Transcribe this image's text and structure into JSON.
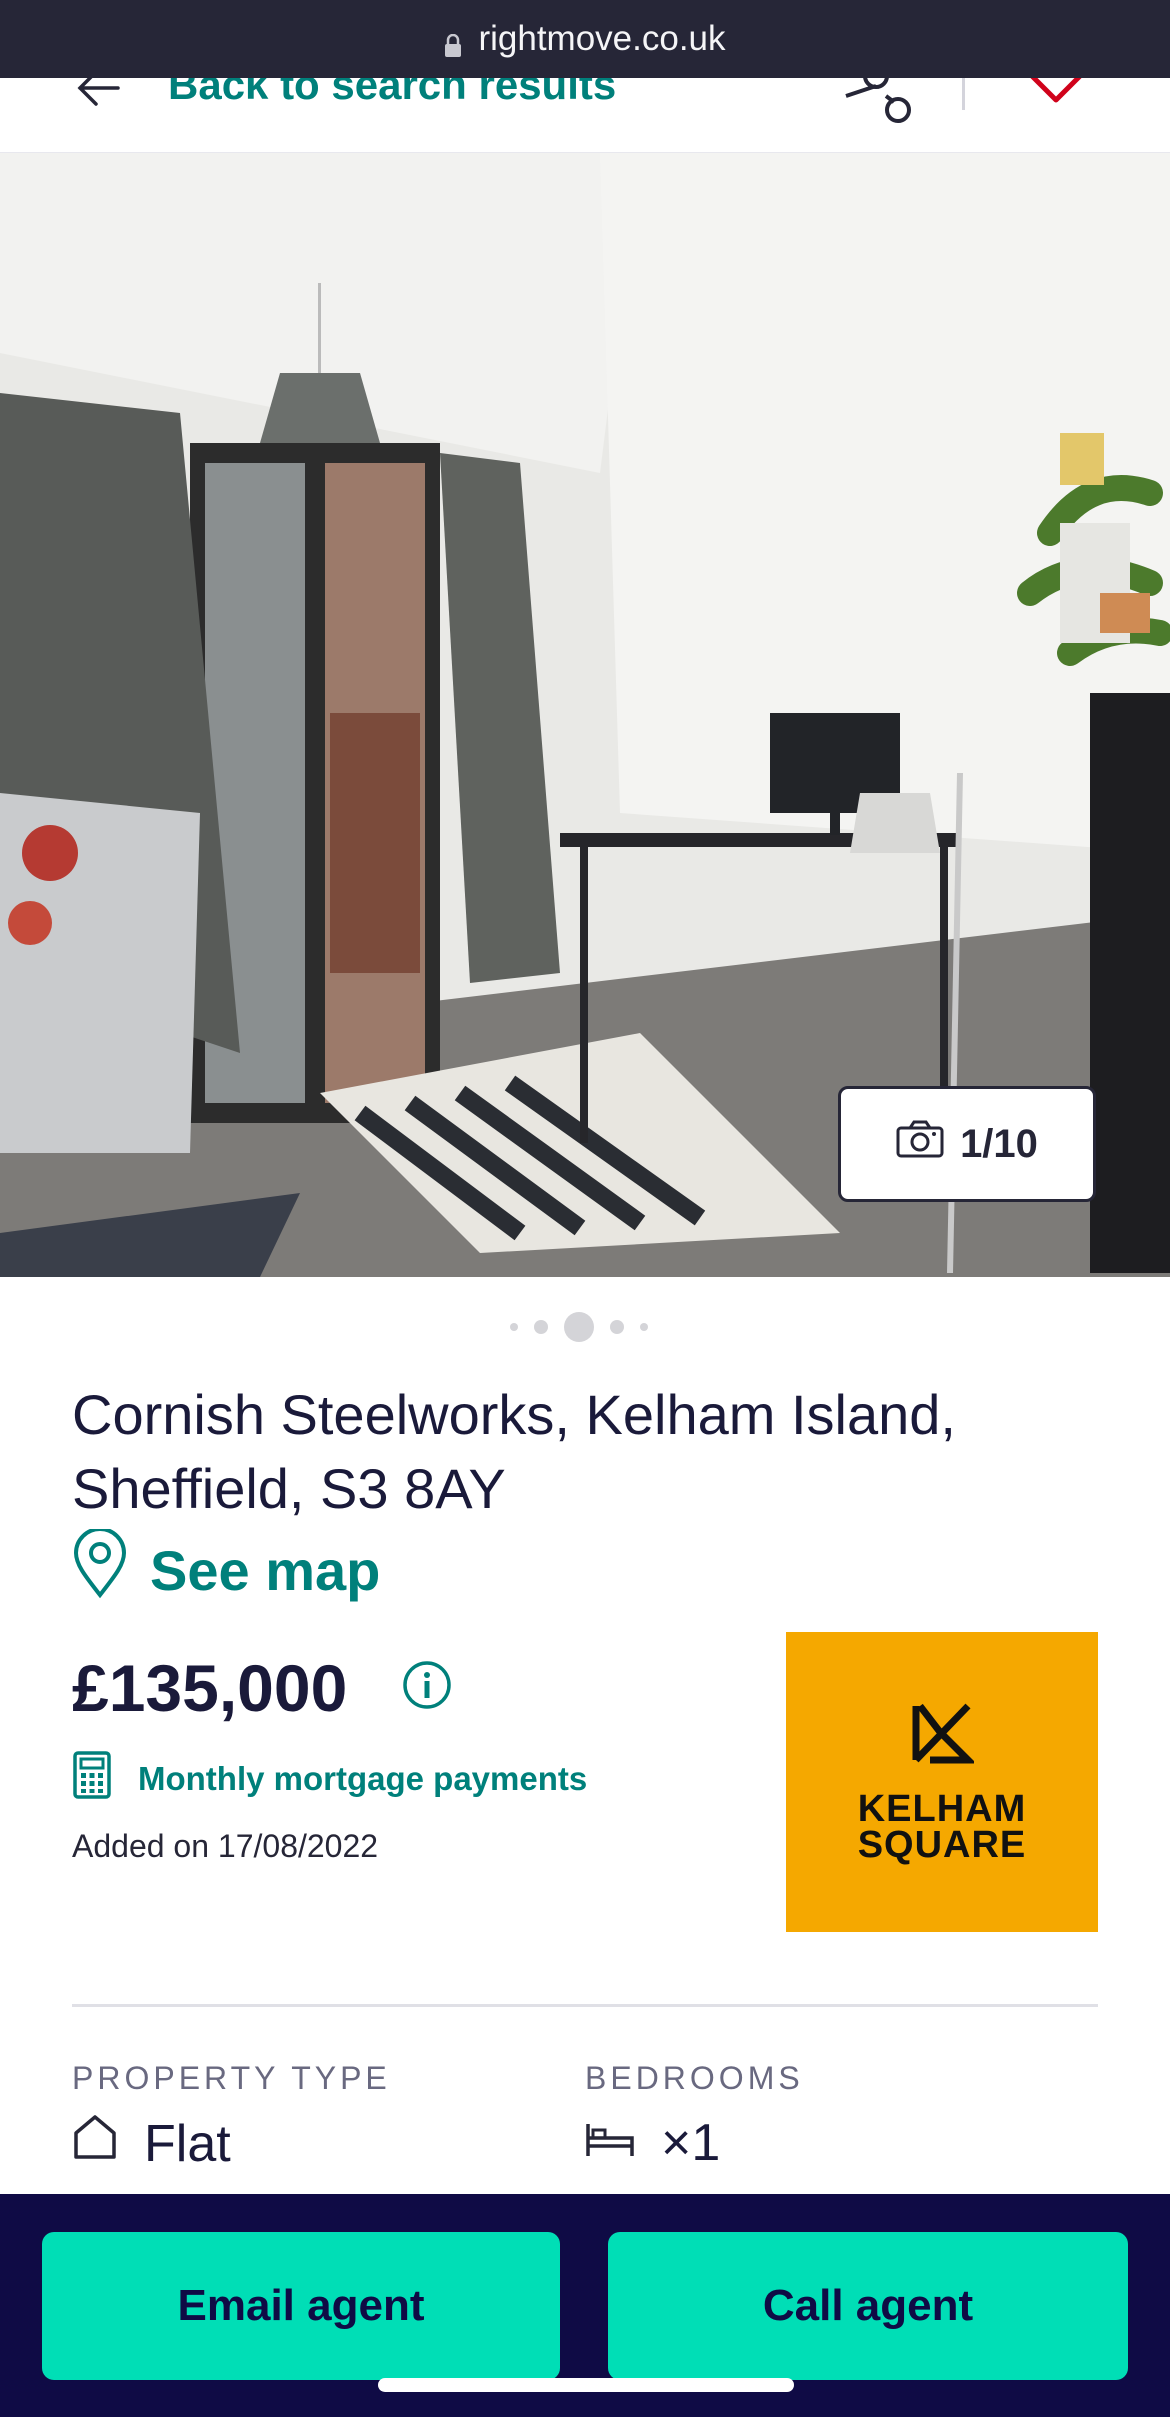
{
  "browser": {
    "url": "rightmove.co.uk"
  },
  "nav": {
    "back_label": "Back to search results"
  },
  "gallery": {
    "counter": "1/10",
    "active_index": 2,
    "dot_count": 5
  },
  "listing": {
    "address_line1": "Cornish Steelworks, Kelham Island,",
    "address_line2": "Sheffield, S3 8AY",
    "see_map": "See map",
    "price": "£135,000",
    "mortgage_link": "Monthly mortgage payments",
    "added": "Added on 17/08/2022"
  },
  "agent": {
    "logo_line1": "KELHAM",
    "logo_line2": "SQUARE"
  },
  "key_features": [
    {
      "label": "PROPERTY TYPE",
      "value": "Flat",
      "icon": "house-icon"
    },
    {
      "label": "BEDROOMS",
      "value": "×1",
      "icon": "bed-icon"
    }
  ],
  "actions": {
    "email": "Email agent",
    "call": "Call agent"
  },
  "colors": {
    "brand_teal": "#00807b",
    "cta": "#00deb6",
    "navy": "#0f0b45",
    "agent_orange": "#f5a800"
  }
}
